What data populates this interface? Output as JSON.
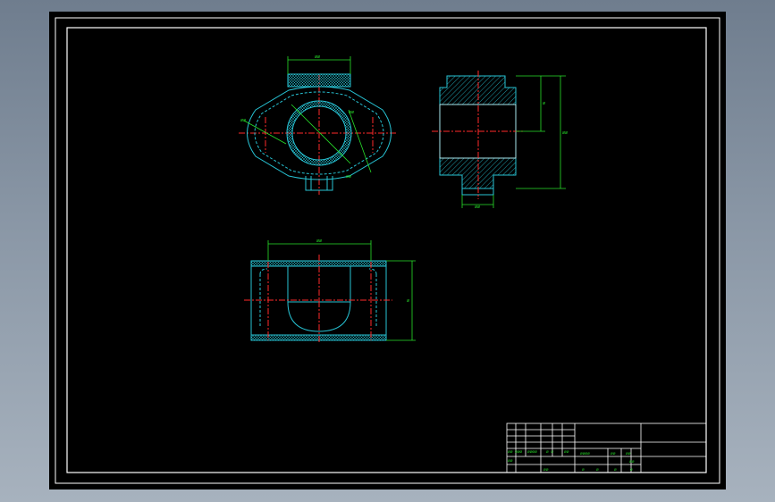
{
  "drawing": {
    "dimensions": {
      "top_view_width": "⌀⌀",
      "top_view_hole": "⌀⌀",
      "top_view_left": "⌀⌀",
      "top_view_bottom": "⌀⌀",
      "section_height_inner": "⌀",
      "section_height_total": "⌀⌀",
      "section_boss_width": "⌀⌀",
      "front_width": "⌀⌀",
      "front_height": "⌀"
    },
    "title_block": {
      "row1": [
        "",
        "",
        "",
        ""
      ],
      "labels_left": [
        "⌀⌀ ⌀⌀⌀",
        "⌀⌀⌀⌀",
        "⌀ ⌀",
        "⌀⌀"
      ],
      "label_design": "⌀⌀",
      "label_process": "⌀⌀",
      "labels_mid": [
        "⌀⌀⌀⌀",
        "⌀⌀",
        "⌀⌀"
      ],
      "scale": "⌀⌀",
      "labels_bottom": [
        "⌀",
        "⌀",
        "⌀",
        "⌀"
      ]
    }
  },
  "colors": {
    "background": "#000000",
    "outline": "#27c3d4",
    "centerline": "#ff2a2a",
    "dimension": "#28e02a",
    "frame": "#ffffff"
  }
}
